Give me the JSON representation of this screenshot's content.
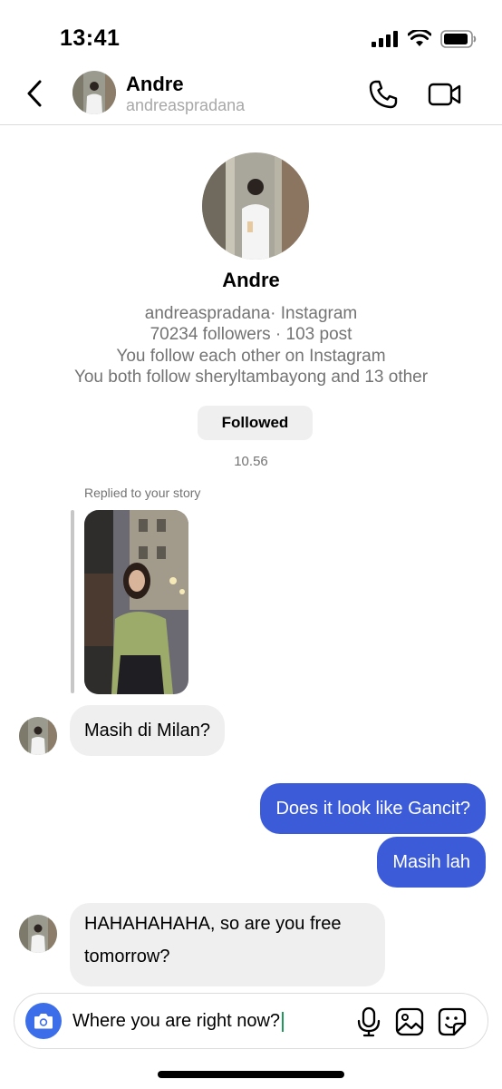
{
  "status_bar": {
    "time": "13:41"
  },
  "header": {
    "name": "Andre",
    "username": "andreaspradana"
  },
  "profile": {
    "name": "Andre",
    "source_line": "andreaspradana· Instagram",
    "stats_line": "70234 followers · 103 post",
    "mutual_line": "You follow each other on Instagram",
    "common_line": "You both follow sheryltambayong and 13 other",
    "followed_label": "Followed"
  },
  "timestamp": "10.56",
  "story_reply": {
    "label": "Replied to your story"
  },
  "messages": [
    {
      "direction": "in",
      "text": "Masih di Milan?"
    },
    {
      "direction": "out",
      "text": "Does it look like Gancit?"
    },
    {
      "direction": "out",
      "text": "Masih lah"
    },
    {
      "direction": "in",
      "text": "HAHAHAHAHA, so are you free tomorrow?"
    }
  ],
  "composer": {
    "text": "Where you are right now?"
  },
  "icons": {
    "back": "chevron-left-icon",
    "call": "phone-icon",
    "video": "video-camera-icon",
    "camera": "camera-icon",
    "mic": "microphone-icon",
    "gallery": "image-icon",
    "sticker": "sticker-icon"
  },
  "colors": {
    "outgoing_bubble": "#3b5bd9",
    "incoming_bubble": "#efefef",
    "camera_button": "#3b6ee8"
  }
}
